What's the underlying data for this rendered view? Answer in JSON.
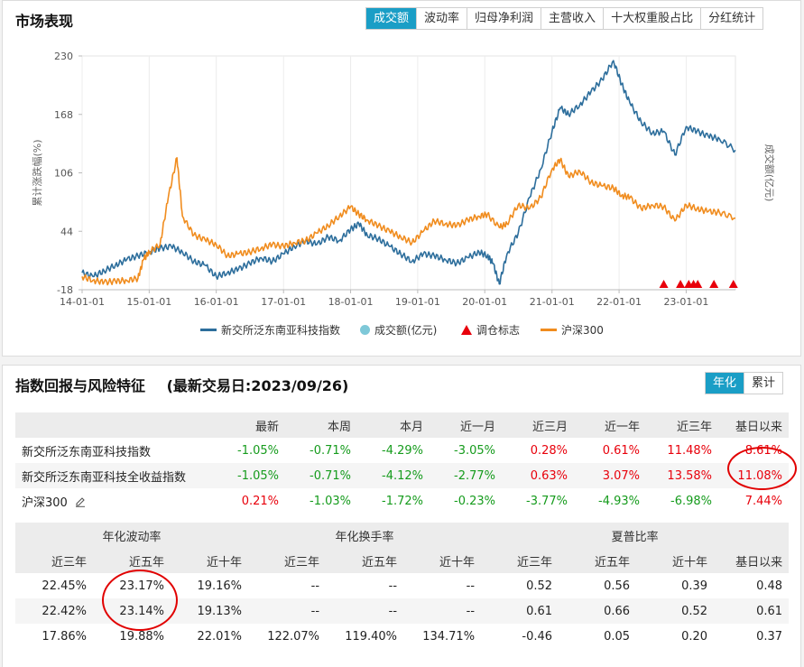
{
  "market": {
    "title": "市场表现",
    "tabs": [
      "成交额",
      "波动率",
      "归母净利润",
      "主营收入",
      "十大权重股占比",
      "分红统计"
    ],
    "active_tab": 0,
    "y_axis_label": "累计涨跌幅(%)",
    "y2_axis_label": "成交额(亿元)",
    "legend": [
      "新交所泛东南亚科技指数",
      "成交额(亿元)",
      "调仓标志",
      "沪深300"
    ]
  },
  "chart_data": {
    "type": "line",
    "xlabel": "",
    "ylabel": "累计涨跌幅(%)",
    "y2label": "成交额(亿元)",
    "ylim": [
      -18,
      230
    ],
    "yticks": [
      -18,
      44,
      106,
      168,
      230
    ],
    "xticks": [
      "14-01-01",
      "15-01-01",
      "16-01-01",
      "17-01-01",
      "18-01-01",
      "19-01-01",
      "20-01-01",
      "21-01-01",
      "22-01-01",
      "23-01-01"
    ],
    "x_range": [
      "2014-01-01",
      "2023-09-26"
    ],
    "grid": "vertical",
    "legend_position": "bottom",
    "series": [
      {
        "name": "新交所泛东南亚科技指数",
        "color": "#2d6e9c",
        "points": [
          [
            "2014-01-01",
            0
          ],
          [
            "2014-03-01",
            -4
          ],
          [
            "2014-05-01",
            2
          ],
          [
            "2014-07-01",
            8
          ],
          [
            "2014-09-01",
            14
          ],
          [
            "2014-11-01",
            18
          ],
          [
            "2015-01-01",
            22
          ],
          [
            "2015-03-01",
            26
          ],
          [
            "2015-05-01",
            28
          ],
          [
            "2015-07-01",
            22
          ],
          [
            "2015-09-01",
            12
          ],
          [
            "2015-11-01",
            8
          ],
          [
            "2016-01-01",
            -4
          ],
          [
            "2016-03-01",
            0
          ],
          [
            "2016-05-01",
            4
          ],
          [
            "2016-07-01",
            10
          ],
          [
            "2016-09-01",
            16
          ],
          [
            "2016-11-01",
            12
          ],
          [
            "2017-01-01",
            20
          ],
          [
            "2017-03-01",
            28
          ],
          [
            "2017-05-01",
            34
          ],
          [
            "2017-07-01",
            30
          ],
          [
            "2017-09-01",
            38
          ],
          [
            "2017-11-01",
            34
          ],
          [
            "2018-01-01",
            46
          ],
          [
            "2018-02-15",
            52
          ],
          [
            "2018-04-01",
            40
          ],
          [
            "2018-06-01",
            36
          ],
          [
            "2018-08-01",
            28
          ],
          [
            "2018-10-01",
            20
          ],
          [
            "2018-12-01",
            12
          ],
          [
            "2019-02-01",
            20
          ],
          [
            "2019-04-01",
            18
          ],
          [
            "2019-06-01",
            14
          ],
          [
            "2019-08-01",
            10
          ],
          [
            "2019-10-01",
            16
          ],
          [
            "2019-12-01",
            22
          ],
          [
            "2020-01-15",
            18
          ],
          [
            "2020-02-15",
            10
          ],
          [
            "2020-03-20",
            -12
          ],
          [
            "2020-05-01",
            20
          ],
          [
            "2020-07-01",
            42
          ],
          [
            "2020-09-01",
            80
          ],
          [
            "2020-11-01",
            110
          ],
          [
            "2021-01-01",
            150
          ],
          [
            "2021-02-15",
            175
          ],
          [
            "2021-04-01",
            168
          ],
          [
            "2021-06-01",
            178
          ],
          [
            "2021-08-01",
            192
          ],
          [
            "2021-10-01",
            205
          ],
          [
            "2021-12-01",
            225
          ],
          [
            "2022-01-15",
            200
          ],
          [
            "2022-03-01",
            180
          ],
          [
            "2022-05-01",
            160
          ],
          [
            "2022-07-01",
            148
          ],
          [
            "2022-09-01",
            150
          ],
          [
            "2022-11-01",
            125
          ],
          [
            "2023-01-01",
            155
          ],
          [
            "2023-03-01",
            150
          ],
          [
            "2023-05-01",
            145
          ],
          [
            "2023-07-01",
            142
          ],
          [
            "2023-09-26",
            130
          ]
        ]
      },
      {
        "name": "沪深300",
        "color": "#f08c1e",
        "points": [
          [
            "2014-01-01",
            -4
          ],
          [
            "2014-03-01",
            -8
          ],
          [
            "2014-05-01",
            -10
          ],
          [
            "2014-07-01",
            -9
          ],
          [
            "2014-09-01",
            -8
          ],
          [
            "2014-11-01",
            -6
          ],
          [
            "2014-12-01",
            14
          ],
          [
            "2015-01-01",
            22
          ],
          [
            "2015-03-01",
            30
          ],
          [
            "2015-04-15",
            80
          ],
          [
            "2015-06-01",
            122
          ],
          [
            "2015-07-01",
            60
          ],
          [
            "2015-09-01",
            40
          ],
          [
            "2015-11-01",
            35
          ],
          [
            "2016-01-01",
            30
          ],
          [
            "2016-03-01",
            18
          ],
          [
            "2016-05-01",
            20
          ],
          [
            "2016-07-01",
            22
          ],
          [
            "2016-09-01",
            26
          ],
          [
            "2016-11-01",
            30
          ],
          [
            "2017-01-01",
            28
          ],
          [
            "2017-03-01",
            32
          ],
          [
            "2017-05-01",
            34
          ],
          [
            "2017-07-01",
            42
          ],
          [
            "2017-09-01",
            50
          ],
          [
            "2017-11-01",
            60
          ],
          [
            "2018-01-01",
            70
          ],
          [
            "2018-02-15",
            62
          ],
          [
            "2018-04-01",
            56
          ],
          [
            "2018-06-01",
            50
          ],
          [
            "2018-08-01",
            44
          ],
          [
            "2018-10-01",
            38
          ],
          [
            "2018-12-01",
            32
          ],
          [
            "2019-02-01",
            44
          ],
          [
            "2019-04-01",
            55
          ],
          [
            "2019-06-01",
            52
          ],
          [
            "2019-08-01",
            50
          ],
          [
            "2019-10-01",
            56
          ],
          [
            "2019-12-01",
            60
          ],
          [
            "2020-01-15",
            62
          ],
          [
            "2020-03-20",
            48
          ],
          [
            "2020-05-01",
            52
          ],
          [
            "2020-07-01",
            72
          ],
          [
            "2020-09-01",
            68
          ],
          [
            "2020-11-01",
            80
          ],
          [
            "2021-01-01",
            110
          ],
          [
            "2021-02-15",
            120
          ],
          [
            "2021-04-01",
            102
          ],
          [
            "2021-06-01",
            108
          ],
          [
            "2021-08-01",
            96
          ],
          [
            "2021-10-01",
            92
          ],
          [
            "2021-12-01",
            90
          ],
          [
            "2022-01-15",
            82
          ],
          [
            "2022-03-01",
            80
          ],
          [
            "2022-05-01",
            68
          ],
          [
            "2022-07-01",
            72
          ],
          [
            "2022-09-01",
            70
          ],
          [
            "2022-11-01",
            55
          ],
          [
            "2023-01-01",
            72
          ],
          [
            "2023-03-01",
            68
          ],
          [
            "2023-05-01",
            65
          ],
          [
            "2023-07-01",
            64
          ],
          [
            "2023-09-26",
            58
          ]
        ]
      }
    ],
    "markers": {
      "name": "调仓标志",
      "color": "#e8000b",
      "dates": [
        "2022-09-01",
        "2022-12-01",
        "2023-01-15",
        "2023-02-10",
        "2023-03-05",
        "2023-06-01",
        "2023-09-15"
      ]
    }
  },
  "returns": {
    "title": "指数回报与风险特征",
    "latest_date": "(最新交易日:2023/09/26)",
    "toggle": [
      "年化",
      "累计"
    ],
    "active_toggle": 0,
    "headers": [
      "",
      "最新",
      "本周",
      "本月",
      "近一月",
      "近三月",
      "近一年",
      "近三年",
      "基日以来"
    ],
    "rows": [
      {
        "name": "新交所泛东南亚科技指数",
        "values": [
          "-1.05%",
          "-0.71%",
          "-4.29%",
          "-3.05%",
          "0.28%",
          "0.61%",
          "11.48%",
          "8.61%"
        ]
      },
      {
        "name": "新交所泛东南亚科技全收益指数",
        "values": [
          "-1.05%",
          "-0.71%",
          "-4.12%",
          "-2.77%",
          "0.63%",
          "3.07%",
          "13.58%",
          "11.08%"
        ]
      },
      {
        "name": "沪深300",
        "values": [
          "0.21%",
          "-1.03%",
          "-1.72%",
          "-0.23%",
          "-3.77%",
          "-4.93%",
          "-6.98%",
          "7.44%"
        ]
      }
    ]
  },
  "risk": {
    "groups": [
      "年化波动率",
      "年化换手率",
      "夏普比率"
    ],
    "headers": [
      "近三年",
      "近五年",
      "近十年",
      "近三年",
      "近五年",
      "近十年",
      "近三年",
      "近五年",
      "近十年",
      "基日以来"
    ],
    "rows": [
      [
        "22.45%",
        "23.17%",
        "19.16%",
        "--",
        "--",
        "--",
        "0.52",
        "0.56",
        "0.39",
        "0.48"
      ],
      [
        "22.42%",
        "23.14%",
        "19.13%",
        "--",
        "--",
        "--",
        "0.61",
        "0.66",
        "0.52",
        "0.61"
      ],
      [
        "17.86%",
        "19.88%",
        "22.01%",
        "122.07%",
        "119.40%",
        "134.71%",
        "-0.46",
        "0.05",
        "0.20",
        "0.37"
      ]
    ]
  }
}
